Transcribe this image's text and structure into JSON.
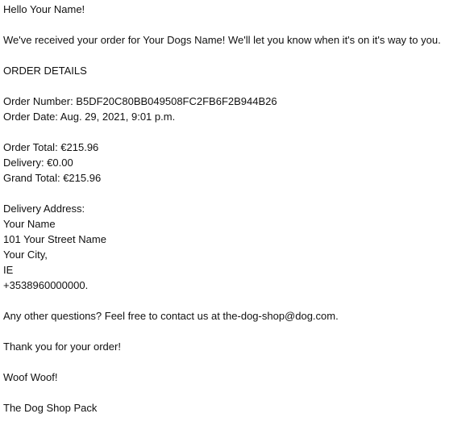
{
  "email": {
    "greeting": "Hello Your Name!",
    "intro": "We've received your order for Your Dogs Name! We'll let you know when it's on it's way to you.",
    "section_heading": "ORDER DETAILS",
    "order_number_line": "Order Number: B5DF20C80BB049508FC2FB6F2B944B26",
    "order_date_line": "Order Date: Aug. 29, 2021, 9:01 p.m.",
    "order_total_line": "Order Total: €215.96",
    "delivery_line": "Delivery: €0.00",
    "grand_total_line": "Grand Total: €215.96",
    "address_heading": "Delivery Address:",
    "address": {
      "name": "Your Name",
      "street": "101 Your Street Name",
      "city": "Your City,",
      "country": "IE",
      "phone": "+3538960000000."
    },
    "questions_line": "Any other questions? Feel free to contact us at the-dog-shop@dog.com.",
    "thanks_line": "Thank you for your order!",
    "woof_line": "Woof Woof!",
    "signature": "The Dog Shop Pack"
  }
}
